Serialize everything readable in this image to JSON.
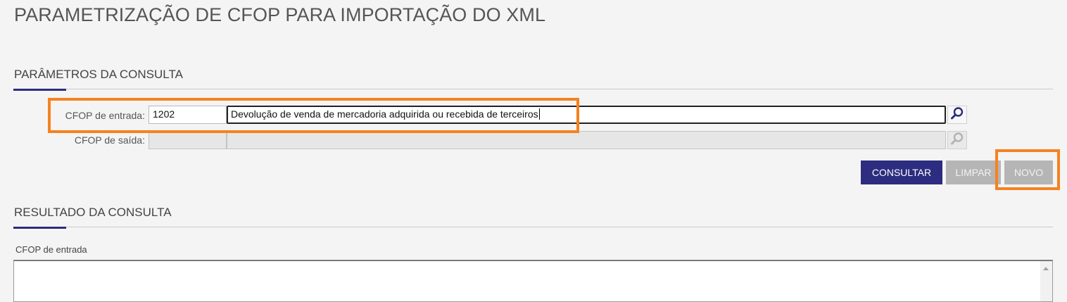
{
  "page": {
    "title": "PARAMETRIZAÇÃO DE CFOP PARA IMPORTAÇÃO DO XML"
  },
  "params_section": {
    "title": "PARÂMETROS DA CONSULTA",
    "cfop_entrada": {
      "label": "CFOP de entrada:",
      "code": "1202",
      "description": "Devolução de venda de mercadoria adquirida ou recebida de terceiros",
      "lookup_icon": "search-icon"
    },
    "cfop_saida": {
      "label": "CFOP de saída:",
      "code": "",
      "description": "",
      "lookup_icon": "search-icon",
      "disabled": true
    }
  },
  "actions": {
    "consultar": "CONSULTAR",
    "limpar": "LIMPAR",
    "novo": "NOVO"
  },
  "results_section": {
    "title": "RESULTADO DA CONSULTA",
    "columns": [
      "CFOP de entrada"
    ]
  },
  "colors": {
    "accent": "#2c2c80",
    "highlight": "#f58220",
    "disabled_button": "#b5b5b5"
  }
}
